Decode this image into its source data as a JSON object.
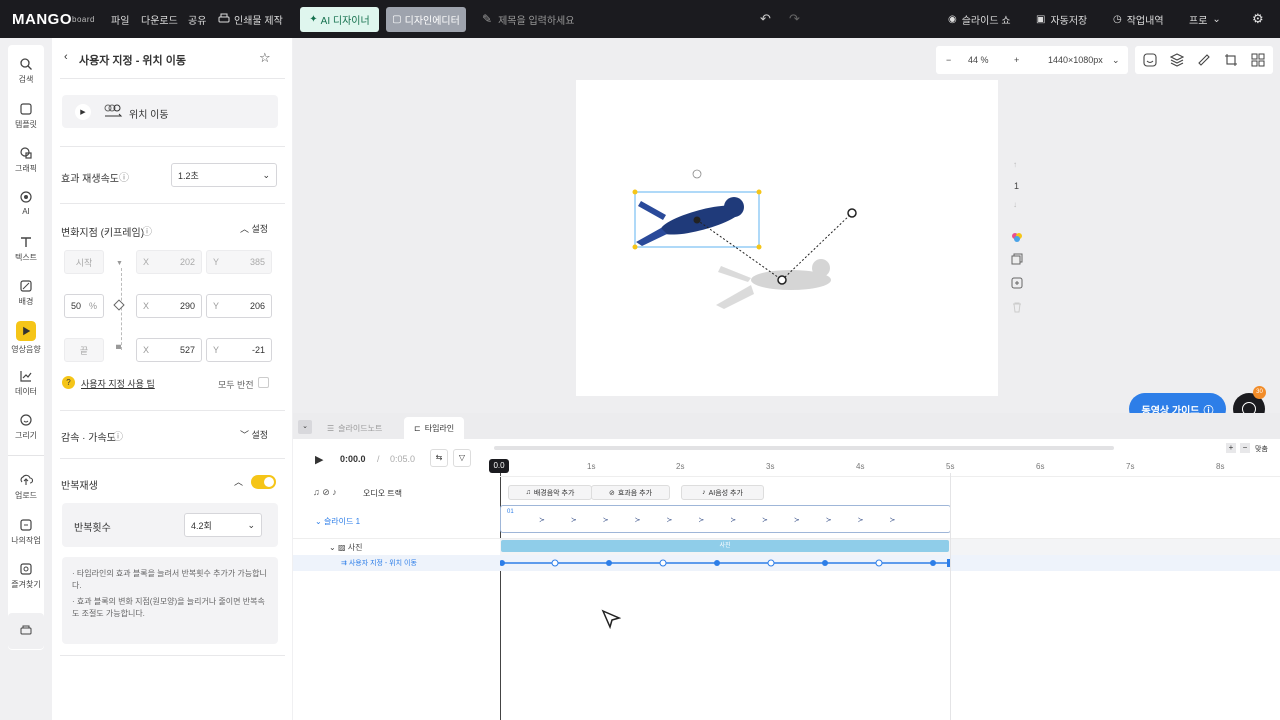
{
  "topbar": {
    "logo": "MANGO",
    "logo_sub": "board",
    "menu": [
      "파일",
      "다운로드",
      "공유"
    ],
    "print_label": "인쇄물 제작",
    "ai_designer": "AI 디자이너",
    "design_editor": "디자인에디터",
    "title_placeholder": "제목을 입력하세요",
    "slideshow": "슬라이드 쇼",
    "autosave": "자동저장",
    "history": "작업내역",
    "plan": "프로"
  },
  "sidebar": {
    "items": [
      {
        "label": "검색",
        "icon": "search-icon"
      },
      {
        "label": "템플릿",
        "icon": "template-icon"
      },
      {
        "label": "그래픽",
        "icon": "graphic-icon"
      },
      {
        "label": "AI",
        "icon": "ai-icon"
      },
      {
        "label": "텍스트",
        "icon": "text-icon"
      },
      {
        "label": "배경",
        "icon": "background-icon"
      },
      {
        "label": "영상음향",
        "icon": "video-audio-icon"
      },
      {
        "label": "데이터",
        "icon": "data-icon"
      },
      {
        "label": "그리기",
        "icon": "draw-icon"
      },
      {
        "label": "업로드",
        "icon": "upload-icon"
      },
      {
        "label": "나의작업",
        "icon": "my-work-icon"
      },
      {
        "label": "즐겨찾기",
        "icon": "favorites-icon"
      }
    ],
    "active": "영상음향",
    "accent": "#f5c518"
  },
  "panel": {
    "title": "사용자 지정 - 위치 이동",
    "preview_label": "위치 이동",
    "speed_label": "효과 재생속도",
    "speed_value": "1.2초",
    "keyframe_label": "변화지점 (키프레임)",
    "keyframe_action": "설정",
    "rows": [
      {
        "name": "시작",
        "x": "202",
        "y": "385"
      },
      {
        "name": "50",
        "unit": "%",
        "x": "290",
        "y": "206"
      },
      {
        "name": "끝",
        "x": "527",
        "y": "-21"
      }
    ],
    "x_label": "X",
    "y_label": "Y",
    "tip_link": "사용자 지정 사용 팁",
    "flip_all": "모두 반전",
    "ease_label": "감속 · 가속도",
    "ease_action": "설정",
    "repeat_label": "반복재생",
    "repeat_count_label": "반복횟수",
    "repeat_count_value": "4.2회",
    "notes": [
      "· 타임라인의 효과 블록을 늘려서 반복횟수 추가가 가능합니다.",
      "· 효과 블록의 변화 지점(원모양)을 늘리거나 줄이면 반복속도 조절도 가능합니다."
    ]
  },
  "canvas": {
    "zoom": "44 %",
    "zoom_minus": "−",
    "zoom_plus": "+",
    "size": "1440×1080px",
    "page_number": "1"
  },
  "guide_button": "동영상 가이드",
  "chat_badge": "30",
  "timeline": {
    "tabs": [
      "슬라이드노트",
      "타임라인"
    ],
    "current_time": "0:00.0",
    "separator": "/",
    "total_time": "0:05.0",
    "playhead": "0.0",
    "ticks": [
      "1s",
      "2s",
      "3s",
      "4s",
      "5s",
      "6s",
      "7s",
      "8s"
    ],
    "audio_track": "오디오 트랙",
    "add_bgm": "배경음악 추가",
    "add_sfx": "효과음 추가",
    "add_ai_voice": "AI음성 추가",
    "slide_label": "슬라이드 1",
    "slide_num": "01",
    "photo_label": "사진",
    "photo_bar": "사진",
    "effect_label": "사용자 지정 - 위치 이동",
    "fit_label": "맞춤",
    "accent": "#2d7ee8"
  }
}
